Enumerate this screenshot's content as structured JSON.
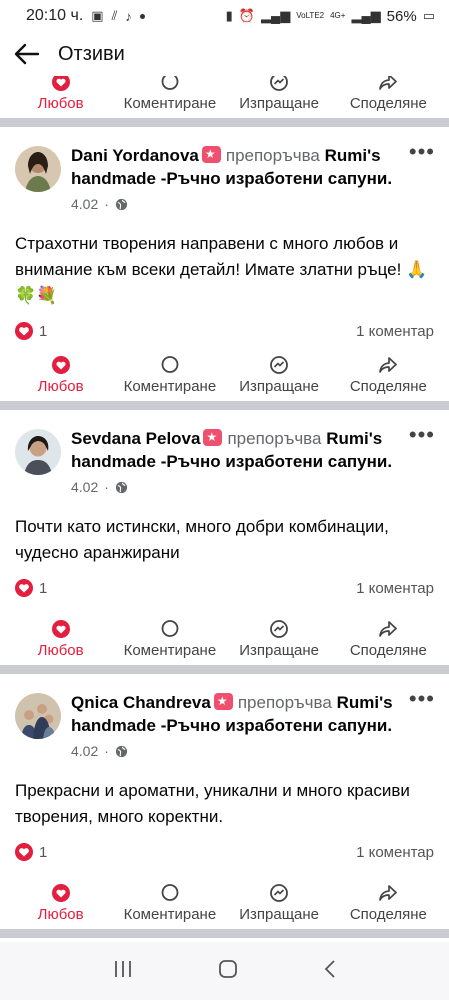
{
  "status": {
    "time": "20:10 ч.",
    "network": "VoLTE2",
    "network_type": "4G+",
    "battery": "56%"
  },
  "appbar": {
    "title": "Отзиви"
  },
  "actions": {
    "love": "Любов",
    "comment": "Коментиране",
    "send": "Изпращане",
    "share": "Споделяне"
  },
  "posts": [
    {
      "author": "Dani Yordanova",
      "recommends": "препоръчва",
      "page": "Rumi's handmade -Ръчно изработени сапуни",
      "date": "4.02",
      "text": "Страхотни творения направени с много любов и внимание към всеки детайл! Имате златни ръце! 🙏🍀💐",
      "likes": "1",
      "comments": "1 коментар"
    },
    {
      "author": "Sevdana Pelova",
      "recommends": "препоръчва",
      "page": "Rumi's handmade -Ръчно изработени сапуни",
      "date": "4.02",
      "text": "Почти като истински, много добри комбинации, чудесно аранжирани",
      "likes": "1",
      "comments": "1 коментар"
    },
    {
      "author": "Qnica Chandreva",
      "recommends": "препоръчва",
      "page": "Rumi's handmade -Ръчно изработени сапуни",
      "date": "4.02",
      "text": "Прекрасни и ароматни, уникални и много красиви творения, много коректни.",
      "likes": "1",
      "comments": "1 коментар"
    }
  ],
  "colors": {
    "love": "#e41e3f",
    "badge": "#f0506e",
    "separator": "#c9ccd1"
  }
}
